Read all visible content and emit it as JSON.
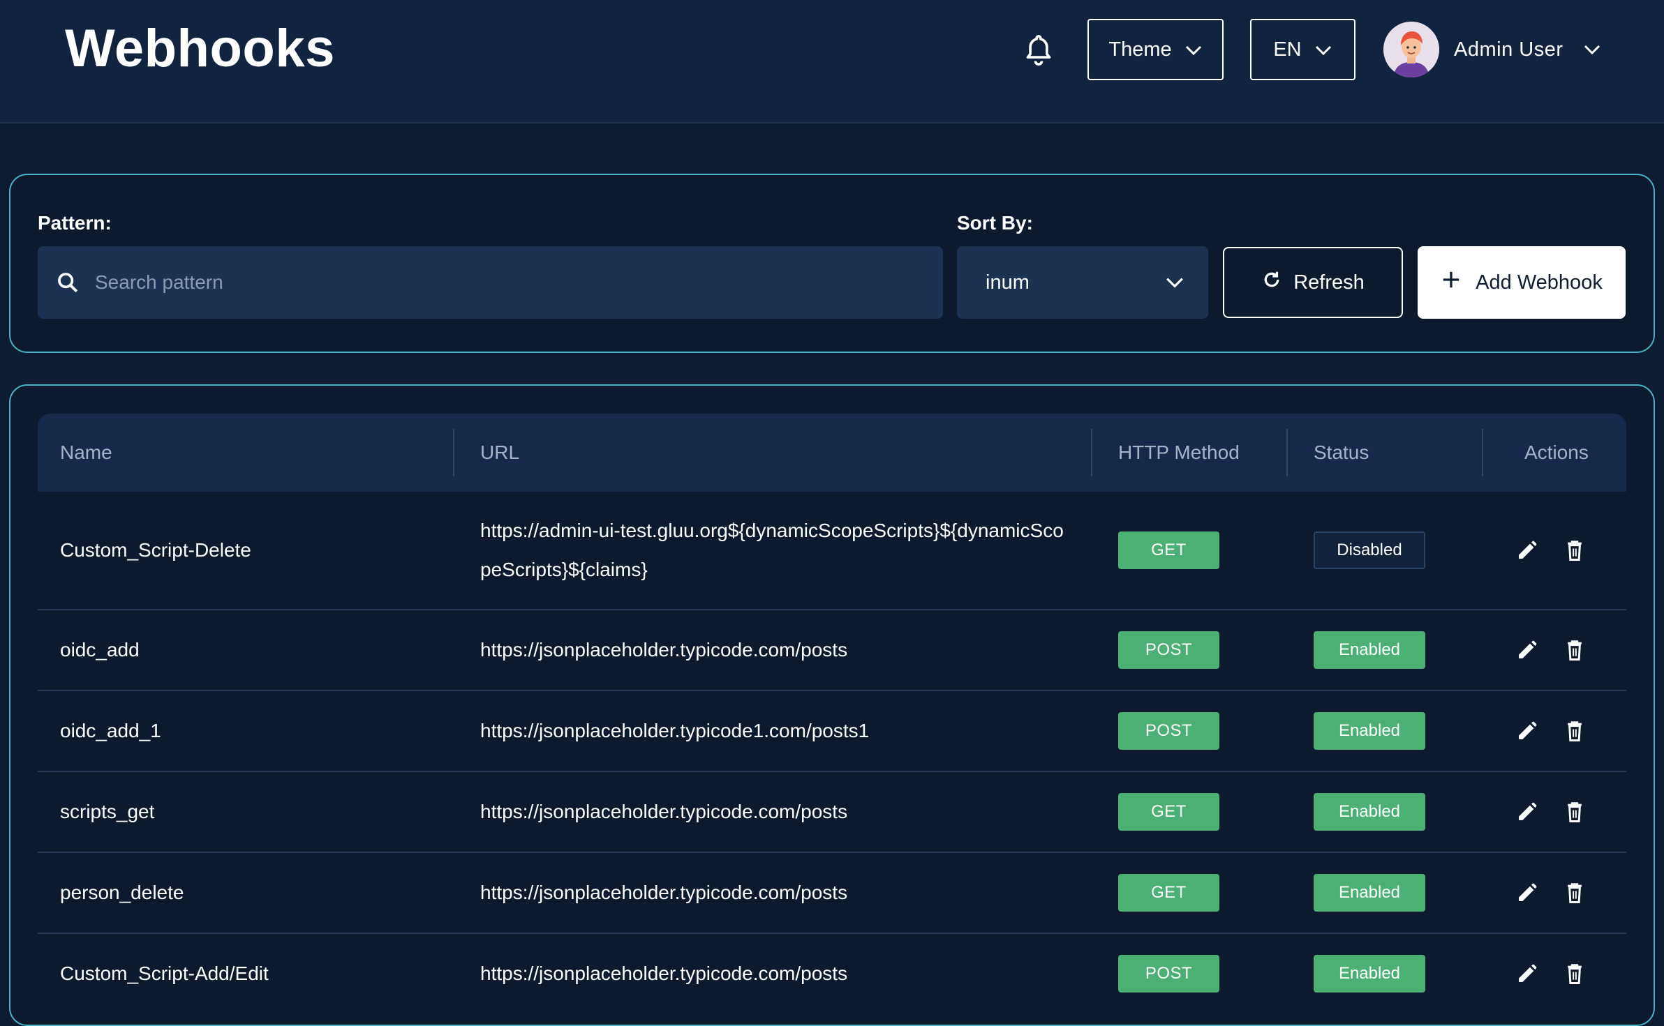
{
  "header": {
    "title": "Webhooks",
    "theme_label": "Theme",
    "lang_label": "EN",
    "user_name": "Admin User"
  },
  "filters": {
    "pattern_label": "Pattern:",
    "search_placeholder": "Search pattern",
    "search_value": "",
    "sort_label": "Sort By:",
    "sort_value": "inum",
    "refresh_label": "Refresh",
    "add_label": "Add Webhook"
  },
  "table": {
    "columns": [
      "Name",
      "URL",
      "HTTP Method",
      "Status",
      "Actions"
    ],
    "rows": [
      {
        "name": "Custom_Script-Delete",
        "url": "https://admin-ui-test.gluu.org${dynamicScopeScripts}${dynamicScopeScripts}${claims}",
        "method": "GET",
        "status": "Disabled"
      },
      {
        "name": "oidc_add",
        "url": "https://jsonplaceholder.typicode.com/posts",
        "method": "POST",
        "status": "Enabled"
      },
      {
        "name": "oidc_add_1",
        "url": "https://jsonplaceholder.typicode1.com/posts1",
        "method": "POST",
        "status": "Enabled"
      },
      {
        "name": "scripts_get",
        "url": "https://jsonplaceholder.typicode.com/posts",
        "method": "GET",
        "status": "Enabled"
      },
      {
        "name": "person_delete",
        "url": "https://jsonplaceholder.typicode.com/posts",
        "method": "GET",
        "status": "Enabled"
      },
      {
        "name": "Custom_Script-Add/Edit",
        "url": "https://jsonplaceholder.typicode.com/posts",
        "method": "POST",
        "status": "Enabled"
      }
    ]
  },
  "icons": {
    "bell": "bell-icon",
    "chevron": "chevron-down-icon",
    "search": "search-icon",
    "refresh": "refresh-icon",
    "add": "plus-icon",
    "edit": "pencil-icon",
    "delete": "trash-icon"
  },
  "colors": {
    "background": "#0e1c31",
    "header": "#12233f",
    "card_border": "#4ab4c7",
    "input": "#1d3253",
    "badge_green": "#4caf73"
  }
}
